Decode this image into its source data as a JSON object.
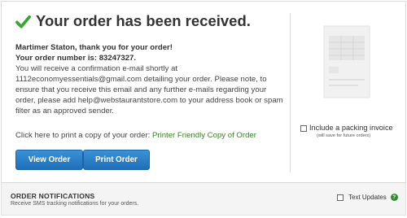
{
  "order": {
    "title": "Your order has been received.",
    "thank_you": "Martimer Staton, thank you for your order!",
    "order_number_label": "Your order number is: ",
    "order_number": "83247327.",
    "confirmation_prefix": "You will receive a confirmation e-mail shortly at",
    "confirmation_body": "1112economyessentials@gmail.com detailing your order. Please note, to ensure that you receive this email and any further e-mails regarding your order, please add help@webstaurantstore.com to your address book or spam filter as an approved sender.",
    "print_prompt": "Click here to print a copy of your order: ",
    "print_link": "Printer Friendly Copy of Order"
  },
  "buttons": {
    "view_order": "View Order",
    "print_order": "Print Order"
  },
  "packing": {
    "label": "Include a packing invoice",
    "note": "(will save for future orders)",
    "checked": false
  },
  "notifications": {
    "title": "ORDER NOTIFICATIONS",
    "subtitle": "Receive SMS tracking notifications for your orders.",
    "text_updates_label": "Text Updates",
    "help_glyph": "?",
    "checked": false
  },
  "colors": {
    "check_green": "#3aa635",
    "link_green": "#3a7d26",
    "button_blue": "#2a7fc8",
    "help_green": "#2e8b2e"
  },
  "icons": {
    "title_icon": "check-icon",
    "illustration": "invoice-document-icon"
  }
}
